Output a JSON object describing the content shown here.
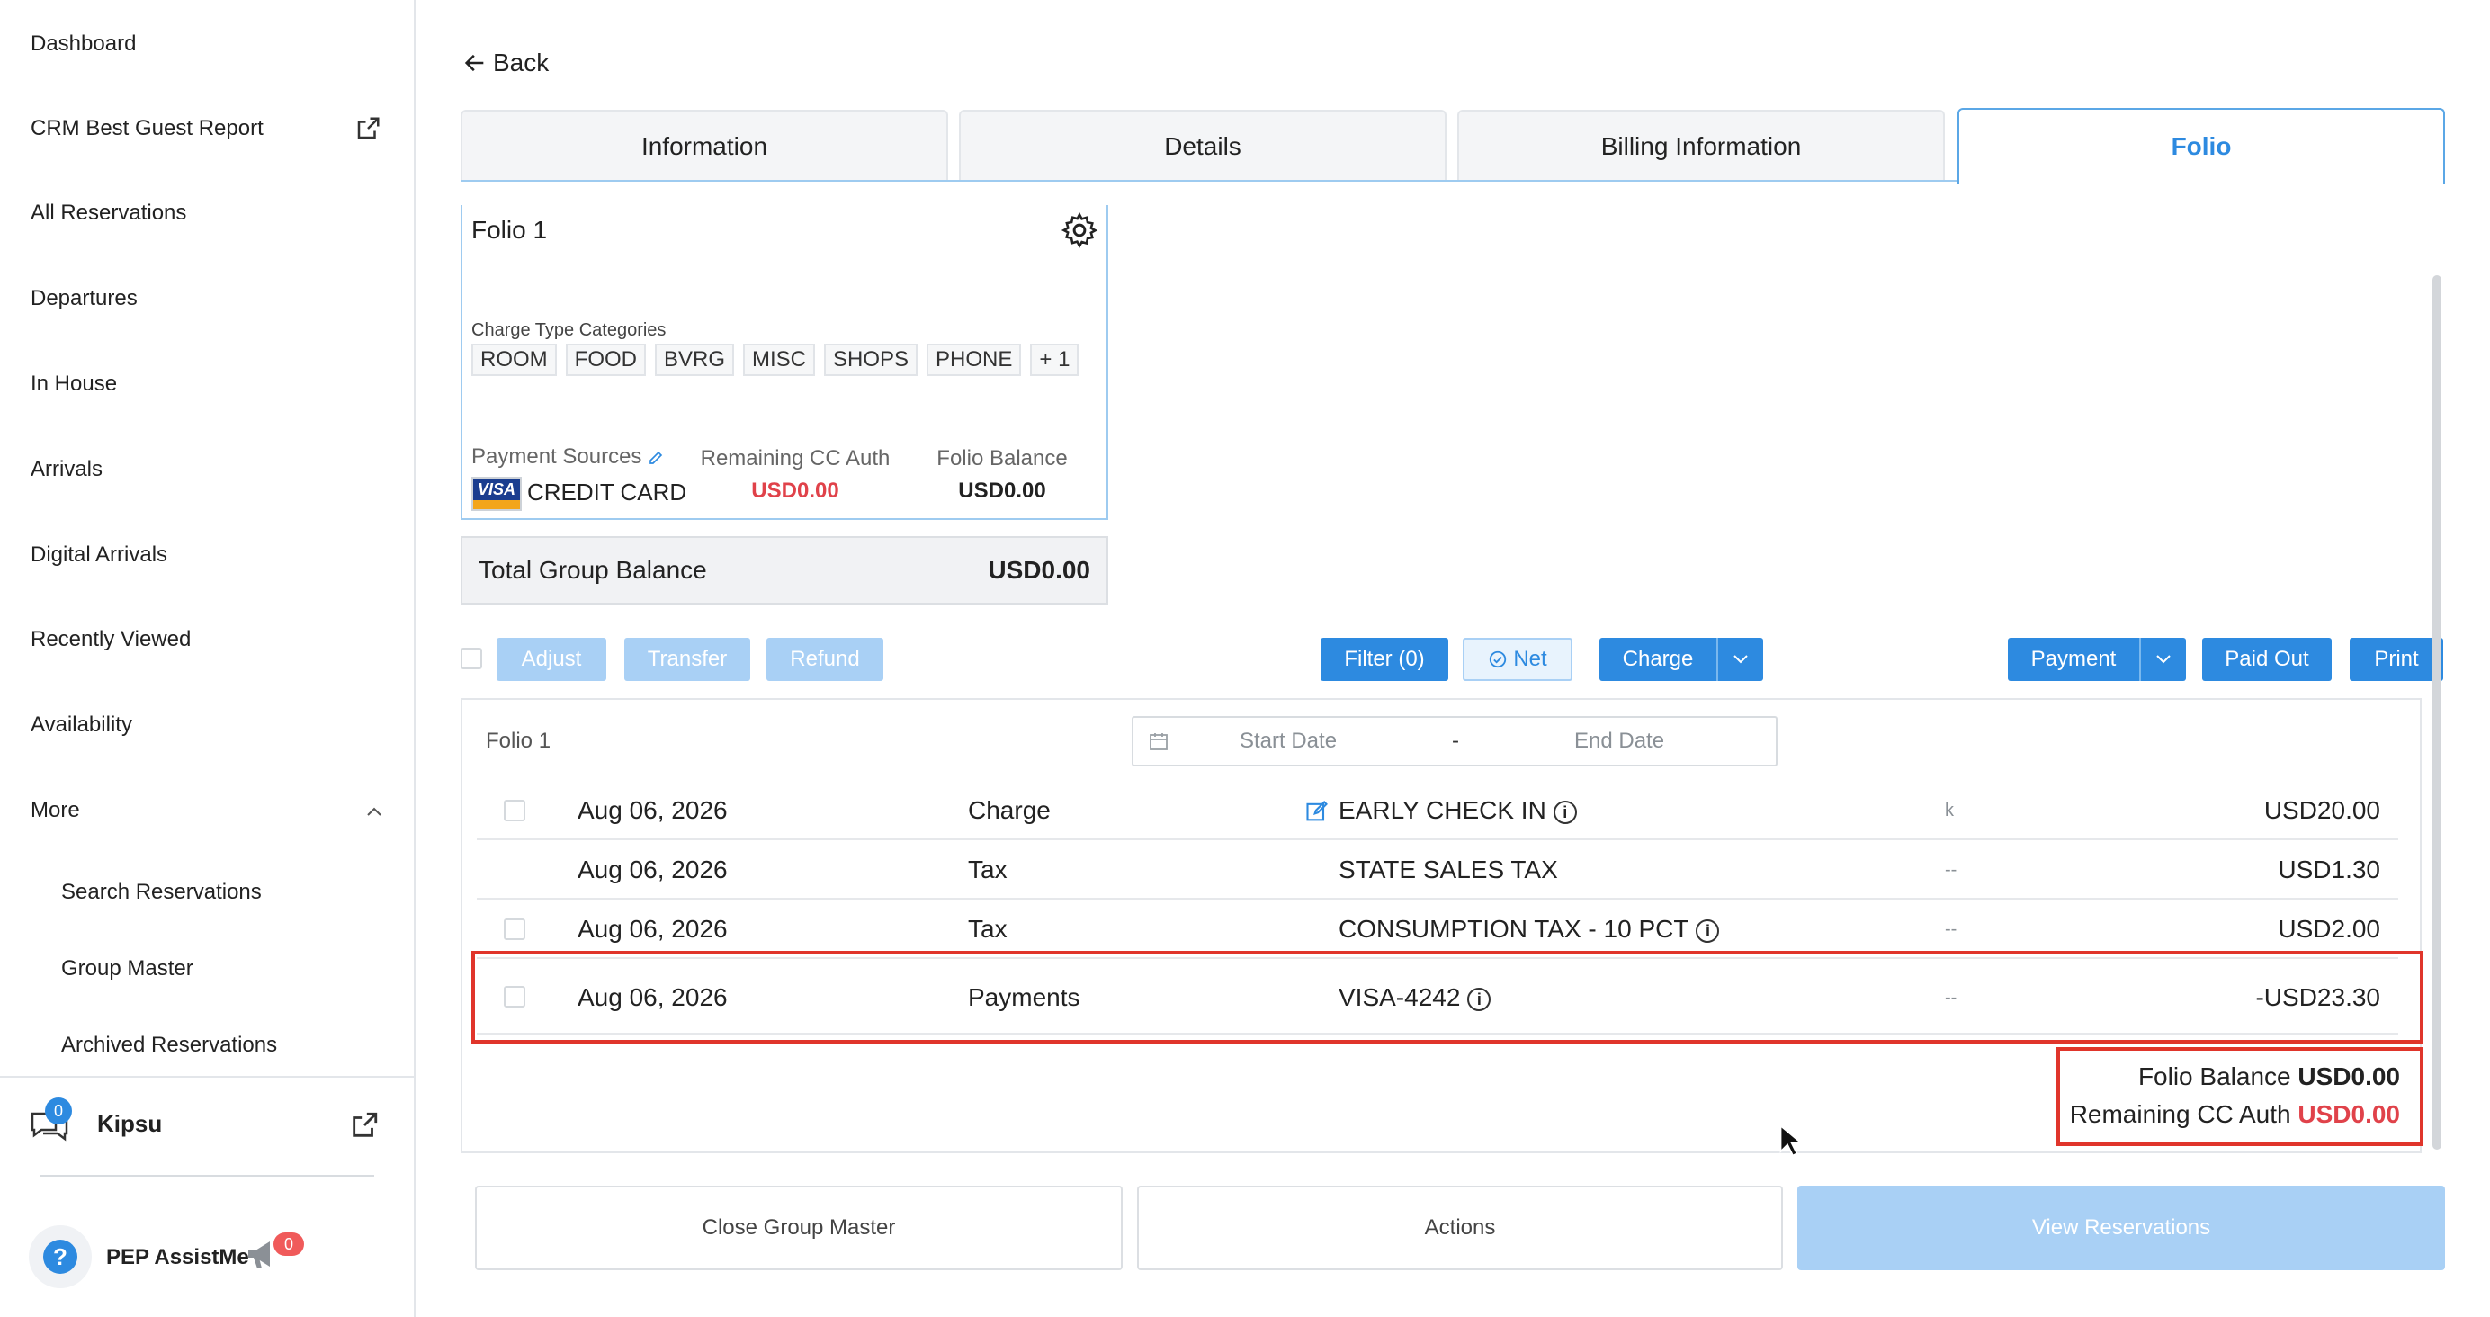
{
  "sidebar": {
    "items": [
      {
        "label": "Dashboard"
      },
      {
        "label": "CRM Best Guest Report"
      },
      {
        "label": "All Reservations"
      },
      {
        "label": "Departures"
      },
      {
        "label": "In House"
      },
      {
        "label": "Arrivals"
      },
      {
        "label": "Digital Arrivals"
      },
      {
        "label": "Recently Viewed"
      },
      {
        "label": "Availability"
      },
      {
        "label": "More"
      }
    ],
    "sub_items": [
      {
        "label": "Search Reservations"
      },
      {
        "label": "Group Master"
      },
      {
        "label": "Archived Reservations"
      }
    ],
    "kipsu": {
      "label": "Kipsu",
      "badge": "0"
    },
    "assist": {
      "label": "PEP AssistMe",
      "badge": "0"
    }
  },
  "header": {
    "back_label": "Back"
  },
  "tabs": [
    {
      "label": "Information",
      "active": false
    },
    {
      "label": "Details",
      "active": false
    },
    {
      "label": "Billing Information",
      "active": false
    },
    {
      "label": "Folio",
      "active": true
    }
  ],
  "folio_card": {
    "title": "Folio 1",
    "categories_label": "Charge Type Categories",
    "categories": [
      "ROOM",
      "FOOD",
      "BVRG",
      "MISC",
      "SHOPS",
      "PHONE",
      "+ 1"
    ],
    "payment_sources_label": "Payment Sources",
    "card_brand": "VISA",
    "payment_source": "CREDIT CARD",
    "remaining_cc_auth_label": "Remaining CC Auth",
    "remaining_cc_auth": "USD0.00",
    "folio_balance_label": "Folio Balance",
    "folio_balance": "USD0.00"
  },
  "total_group": {
    "label": "Total Group Balance",
    "value": "USD0.00"
  },
  "toolbar": {
    "adjust": "Adjust",
    "transfer": "Transfer",
    "refund": "Refund",
    "filter": "Filter (0)",
    "net": "Net",
    "charge": "Charge",
    "payment": "Payment",
    "paid_out": "Paid Out",
    "print": "Print"
  },
  "table": {
    "folio_label": "Folio 1",
    "start_date_placeholder": "Start Date",
    "date_sep": "-",
    "end_date_placeholder": "End Date",
    "rows": [
      {
        "date": "Aug 06, 2026",
        "type": "Charge",
        "description": "EARLY CHECK IN",
        "ref": "k",
        "amount": "USD20.00"
      },
      {
        "date": "Aug 06, 2026",
        "type": "Tax",
        "description": "STATE SALES TAX",
        "ref": "--",
        "amount": "USD1.30"
      },
      {
        "date": "Aug 06, 2026",
        "type": "Tax",
        "description": "CONSUMPTION TAX - 10 PCT",
        "ref": "--",
        "amount": "USD2.00"
      },
      {
        "date": "Aug 06, 2026",
        "type": "Payments",
        "description": "VISA-4242",
        "ref": "--",
        "amount": "-USD23.30"
      }
    ],
    "folio_balance_label": "Folio Balance",
    "folio_balance": "USD0.00",
    "remaining_cc_auth_label": "Remaining CC Auth",
    "remaining_cc_auth": "USD0.00"
  },
  "footer": {
    "close_group_master": "Close Group Master",
    "actions": "Actions",
    "view_reservations": "View Reservations"
  },
  "colors": {
    "accent": "#2d8ae0",
    "negative": "#e0424a",
    "highlight": "#e0352b"
  }
}
